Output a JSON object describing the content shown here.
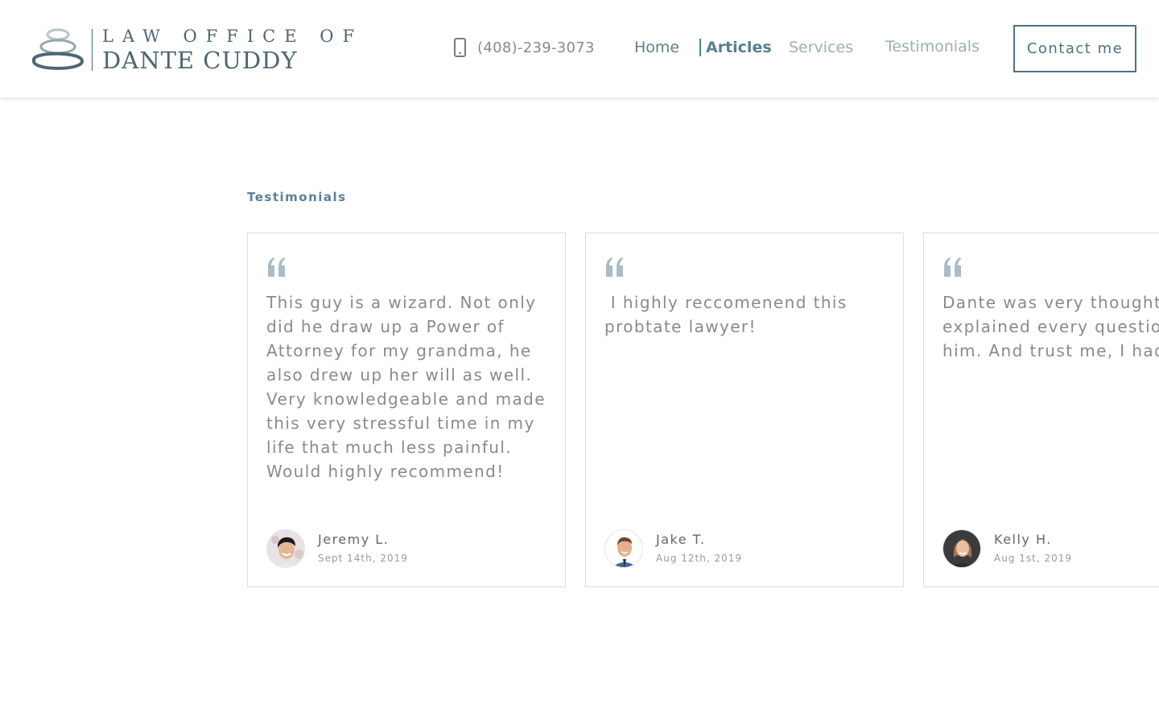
{
  "brand": {
    "line1": "LAW OFFICE OF",
    "line2": "DANTE CUDDY"
  },
  "header": {
    "phone": "(408)-239-3073",
    "nav": {
      "home": "Home",
      "articles": "Articles",
      "services": "Services",
      "testimonials": "Testimonials"
    },
    "contact_label": "Contact me"
  },
  "section": {
    "label": "Testimonials"
  },
  "testimonials": [
    {
      "quote": "This guy is a wizard. Not only did he draw up a Power of Attorney for my grandma, he also drew up her will as well. Very knowledgeable and made this very stressful time in my life that much less painful. Would highly recommend!",
      "name": "Jeremy L.",
      "date": "Sept 14th, 2019"
    },
    {
      "quote": " I highly reccomenend this probtate lawyer!",
      "name": "Jake T.",
      "date": "Aug 12th, 2019"
    },
    {
      "quote": "Dante was very thoughtful and explained every question I had for him. And trust me, I had a lot!",
      "name": "Kelly H.",
      "date": "Aug 1st, 2019"
    }
  ],
  "colors": {
    "brand": "#4d6673",
    "accent": "#587f91",
    "quote_mark": "#a8bdc7"
  }
}
